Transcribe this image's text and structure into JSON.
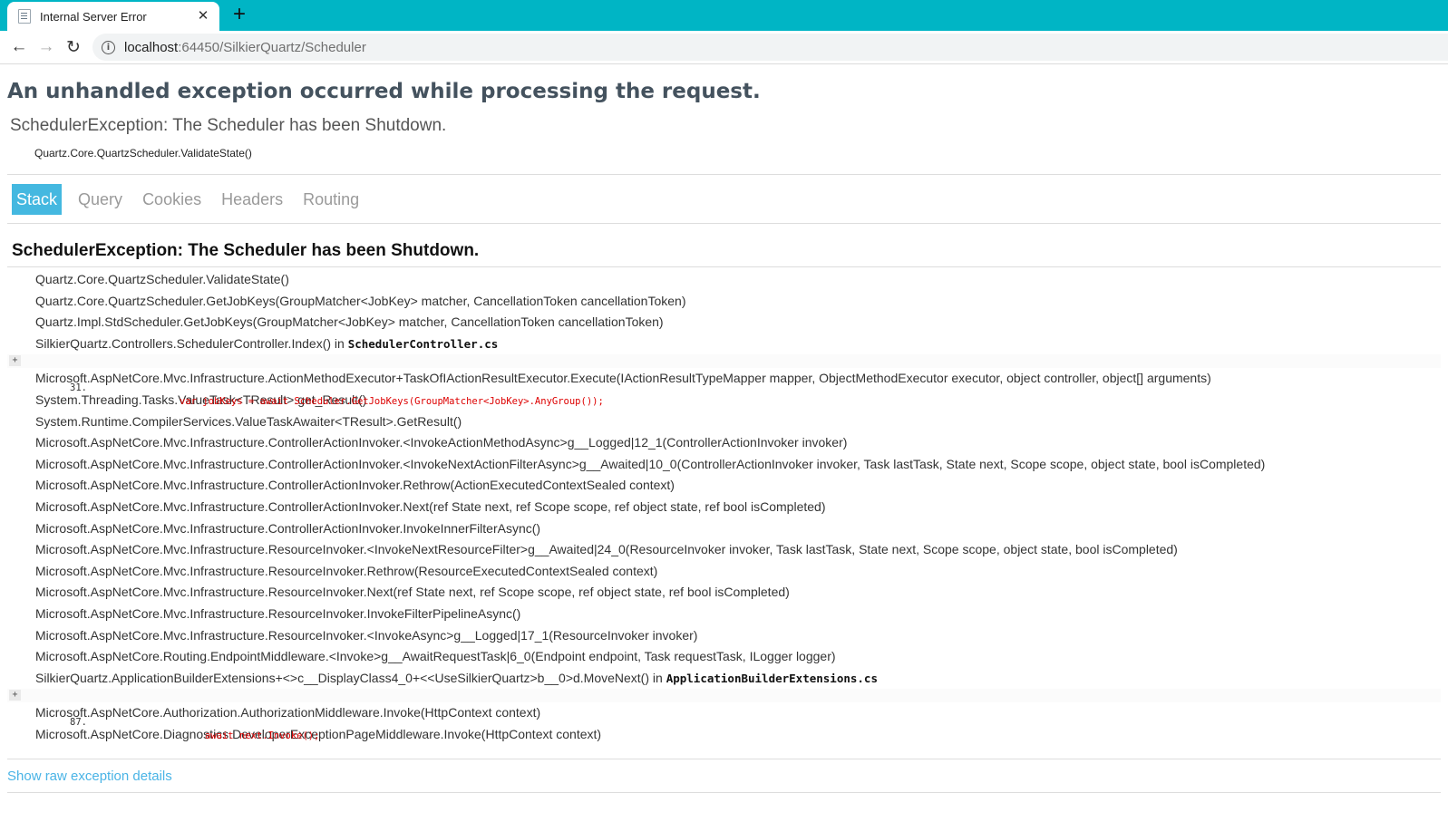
{
  "browser": {
    "tab_title": "Internal Server Error",
    "tab_close": "✕",
    "new_tab": "+",
    "url_host": "localhost",
    "url_rest": ":64450/SilkierQuartz/Scheduler",
    "back_icon": "←",
    "forward_icon": "→",
    "reload_icon": "↻",
    "info_icon": "i"
  },
  "page": {
    "heading": "An unhandled exception occurred while processing the request.",
    "exception_title": "SchedulerException: The Scheduler has been Shutdown.",
    "exception_location": "Quartz.Core.QuartzScheduler.ValidateState()",
    "tabs": [
      {
        "label": "Stack"
      },
      {
        "label": "Query"
      },
      {
        "label": "Cookies"
      },
      {
        "label": "Headers"
      },
      {
        "label": "Routing"
      }
    ],
    "stack_heading": "SchedulerException: The Scheduler has been Shutdown.",
    "frames": [
      {
        "method": "Quartz.Core.QuartzScheduler.ValidateState()"
      },
      {
        "method": "Quartz.Core.QuartzScheduler.GetJobKeys(GroupMatcher<JobKey> matcher, CancellationToken cancellationToken)"
      },
      {
        "method": "Quartz.Impl.StdScheduler.GetJobKeys(GroupMatcher<JobKey> matcher, CancellationToken cancellationToken)"
      },
      {
        "method": "SilkierQuartz.Controllers.SchedulerController.Index() in ",
        "file": "SchedulerController.cs",
        "code": {
          "expander": "+",
          "line": "31.",
          "text": "var jobKeys = await Scheduler.GetJobKeys(GroupMatcher<JobKey>.AnyGroup());"
        }
      },
      {
        "method": "Microsoft.AspNetCore.Mvc.Infrastructure.ActionMethodExecutor+TaskOfIActionResultExecutor.Execute(IActionResultTypeMapper mapper, ObjectMethodExecutor executor, object controller, object[] arguments)"
      },
      {
        "method": "System.Threading.Tasks.ValueTask<TResult>.get_Result()"
      },
      {
        "method": "System.Runtime.CompilerServices.ValueTaskAwaiter<TResult>.GetResult()"
      },
      {
        "method": "Microsoft.AspNetCore.Mvc.Infrastructure.ControllerActionInvoker.<InvokeActionMethodAsync>g__Logged|12_1(ControllerActionInvoker invoker)"
      },
      {
        "method": "Microsoft.AspNetCore.Mvc.Infrastructure.ControllerActionInvoker.<InvokeNextActionFilterAsync>g__Awaited|10_0(ControllerActionInvoker invoker, Task lastTask, State next, Scope scope, object state, bool isCompleted)"
      },
      {
        "method": "Microsoft.AspNetCore.Mvc.Infrastructure.ControllerActionInvoker.Rethrow(ActionExecutedContextSealed context)"
      },
      {
        "method": "Microsoft.AspNetCore.Mvc.Infrastructure.ControllerActionInvoker.Next(ref State next, ref Scope scope, ref object state, ref bool isCompleted)"
      },
      {
        "method": "Microsoft.AspNetCore.Mvc.Infrastructure.ControllerActionInvoker.InvokeInnerFilterAsync()"
      },
      {
        "method": "Microsoft.AspNetCore.Mvc.Infrastructure.ResourceInvoker.<InvokeNextResourceFilter>g__Awaited|24_0(ResourceInvoker invoker, Task lastTask, State next, Scope scope, object state, bool isCompleted)"
      },
      {
        "method": "Microsoft.AspNetCore.Mvc.Infrastructure.ResourceInvoker.Rethrow(ResourceExecutedContextSealed context)"
      },
      {
        "method": "Microsoft.AspNetCore.Mvc.Infrastructure.ResourceInvoker.Next(ref State next, ref Scope scope, ref object state, ref bool isCompleted)"
      },
      {
        "method": "Microsoft.AspNetCore.Mvc.Infrastructure.ResourceInvoker.InvokeFilterPipelineAsync()"
      },
      {
        "method": "Microsoft.AspNetCore.Mvc.Infrastructure.ResourceInvoker.<InvokeAsync>g__Logged|17_1(ResourceInvoker invoker)"
      },
      {
        "method": "Microsoft.AspNetCore.Routing.EndpointMiddleware.<Invoke>g__AwaitRequestTask|6_0(Endpoint endpoint, Task requestTask, ILogger logger)"
      },
      {
        "method": "SilkierQuartz.ApplicationBuilderExtensions+<>c__DisplayClass4_0+<<UseSilkierQuartz>b__0>d.MoveNext() in ",
        "file": "ApplicationBuilderExtensions.cs",
        "code": {
          "expander": "+",
          "line": "87.",
          "text": "await next.Invoke();"
        }
      },
      {
        "method": "Microsoft.AspNetCore.Authorization.AuthorizationMiddleware.Invoke(HttpContext context)"
      },
      {
        "method": "Microsoft.AspNetCore.Diagnostics.DeveloperExceptionPageMiddleware.Invoke(HttpContext context)"
      }
    ],
    "raw_link": "Show raw exception details"
  },
  "colors": {
    "tabstrip": "#00b5c5",
    "active_tab": "#44b8e0",
    "link": "#4ab4e6",
    "code": "#dd0000"
  }
}
